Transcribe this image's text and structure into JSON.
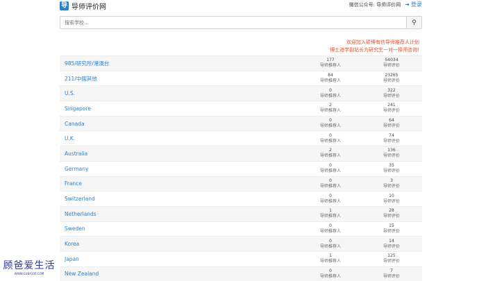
{
  "header": {
    "logo_glyph": "导",
    "site_name": "导师评价网",
    "wechat_text": "微信公众号: 导师评价网",
    "login_label": "登录",
    "login_icon": "sign-in-icon"
  },
  "search": {
    "placeholder": "搜索学校...",
    "button_icon": "search-icon"
  },
  "promo": {
    "line1": "欢迎加入硕博有信导师推荐人计划",
    "line2": "博士进学副站长为研究生一对一择师咨询!"
  },
  "stat_labels": {
    "recommenders": "导师推荐人",
    "reviews": "导师评价"
  },
  "schools": [
    {
      "name": "985/研究所/港澳台",
      "recommenders": "177",
      "reviews": "54034"
    },
    {
      "name": "211/中国其他",
      "recommenders": "84",
      "reviews": "23265"
    },
    {
      "name": "U.S.",
      "recommenders": "0",
      "reviews": "322"
    },
    {
      "name": "Singapore",
      "recommenders": "2",
      "reviews": "241"
    },
    {
      "name": "Canada",
      "recommenders": "0",
      "reviews": "64"
    },
    {
      "name": "U.K.",
      "recommenders": "0",
      "reviews": "74"
    },
    {
      "name": "Australia",
      "recommenders": "2",
      "reviews": "136"
    },
    {
      "name": "Germany",
      "recommenders": "0",
      "reviews": "35"
    },
    {
      "name": "France",
      "recommenders": "0",
      "reviews": "3"
    },
    {
      "name": "Switzerland",
      "recommenders": "0",
      "reviews": "10"
    },
    {
      "name": "Netherlands",
      "recommenders": "1",
      "reviews": "28"
    },
    {
      "name": "Sweden",
      "recommenders": "0",
      "reviews": "15"
    },
    {
      "name": "Korea",
      "recommenders": "0",
      "reviews": "14"
    },
    {
      "name": "Japan",
      "recommenders": "1",
      "reviews": "125"
    },
    {
      "name": "New Zealand",
      "recommenders": "0",
      "reviews": "7"
    }
  ],
  "watermark": {
    "text_cn": "顾爸爱生活",
    "text_en": "WWW.GUBA100.COM"
  },
  "colors": {
    "link": "#2f7fc7",
    "promo": "#e8512c",
    "stripe": "#f6f6f6"
  }
}
